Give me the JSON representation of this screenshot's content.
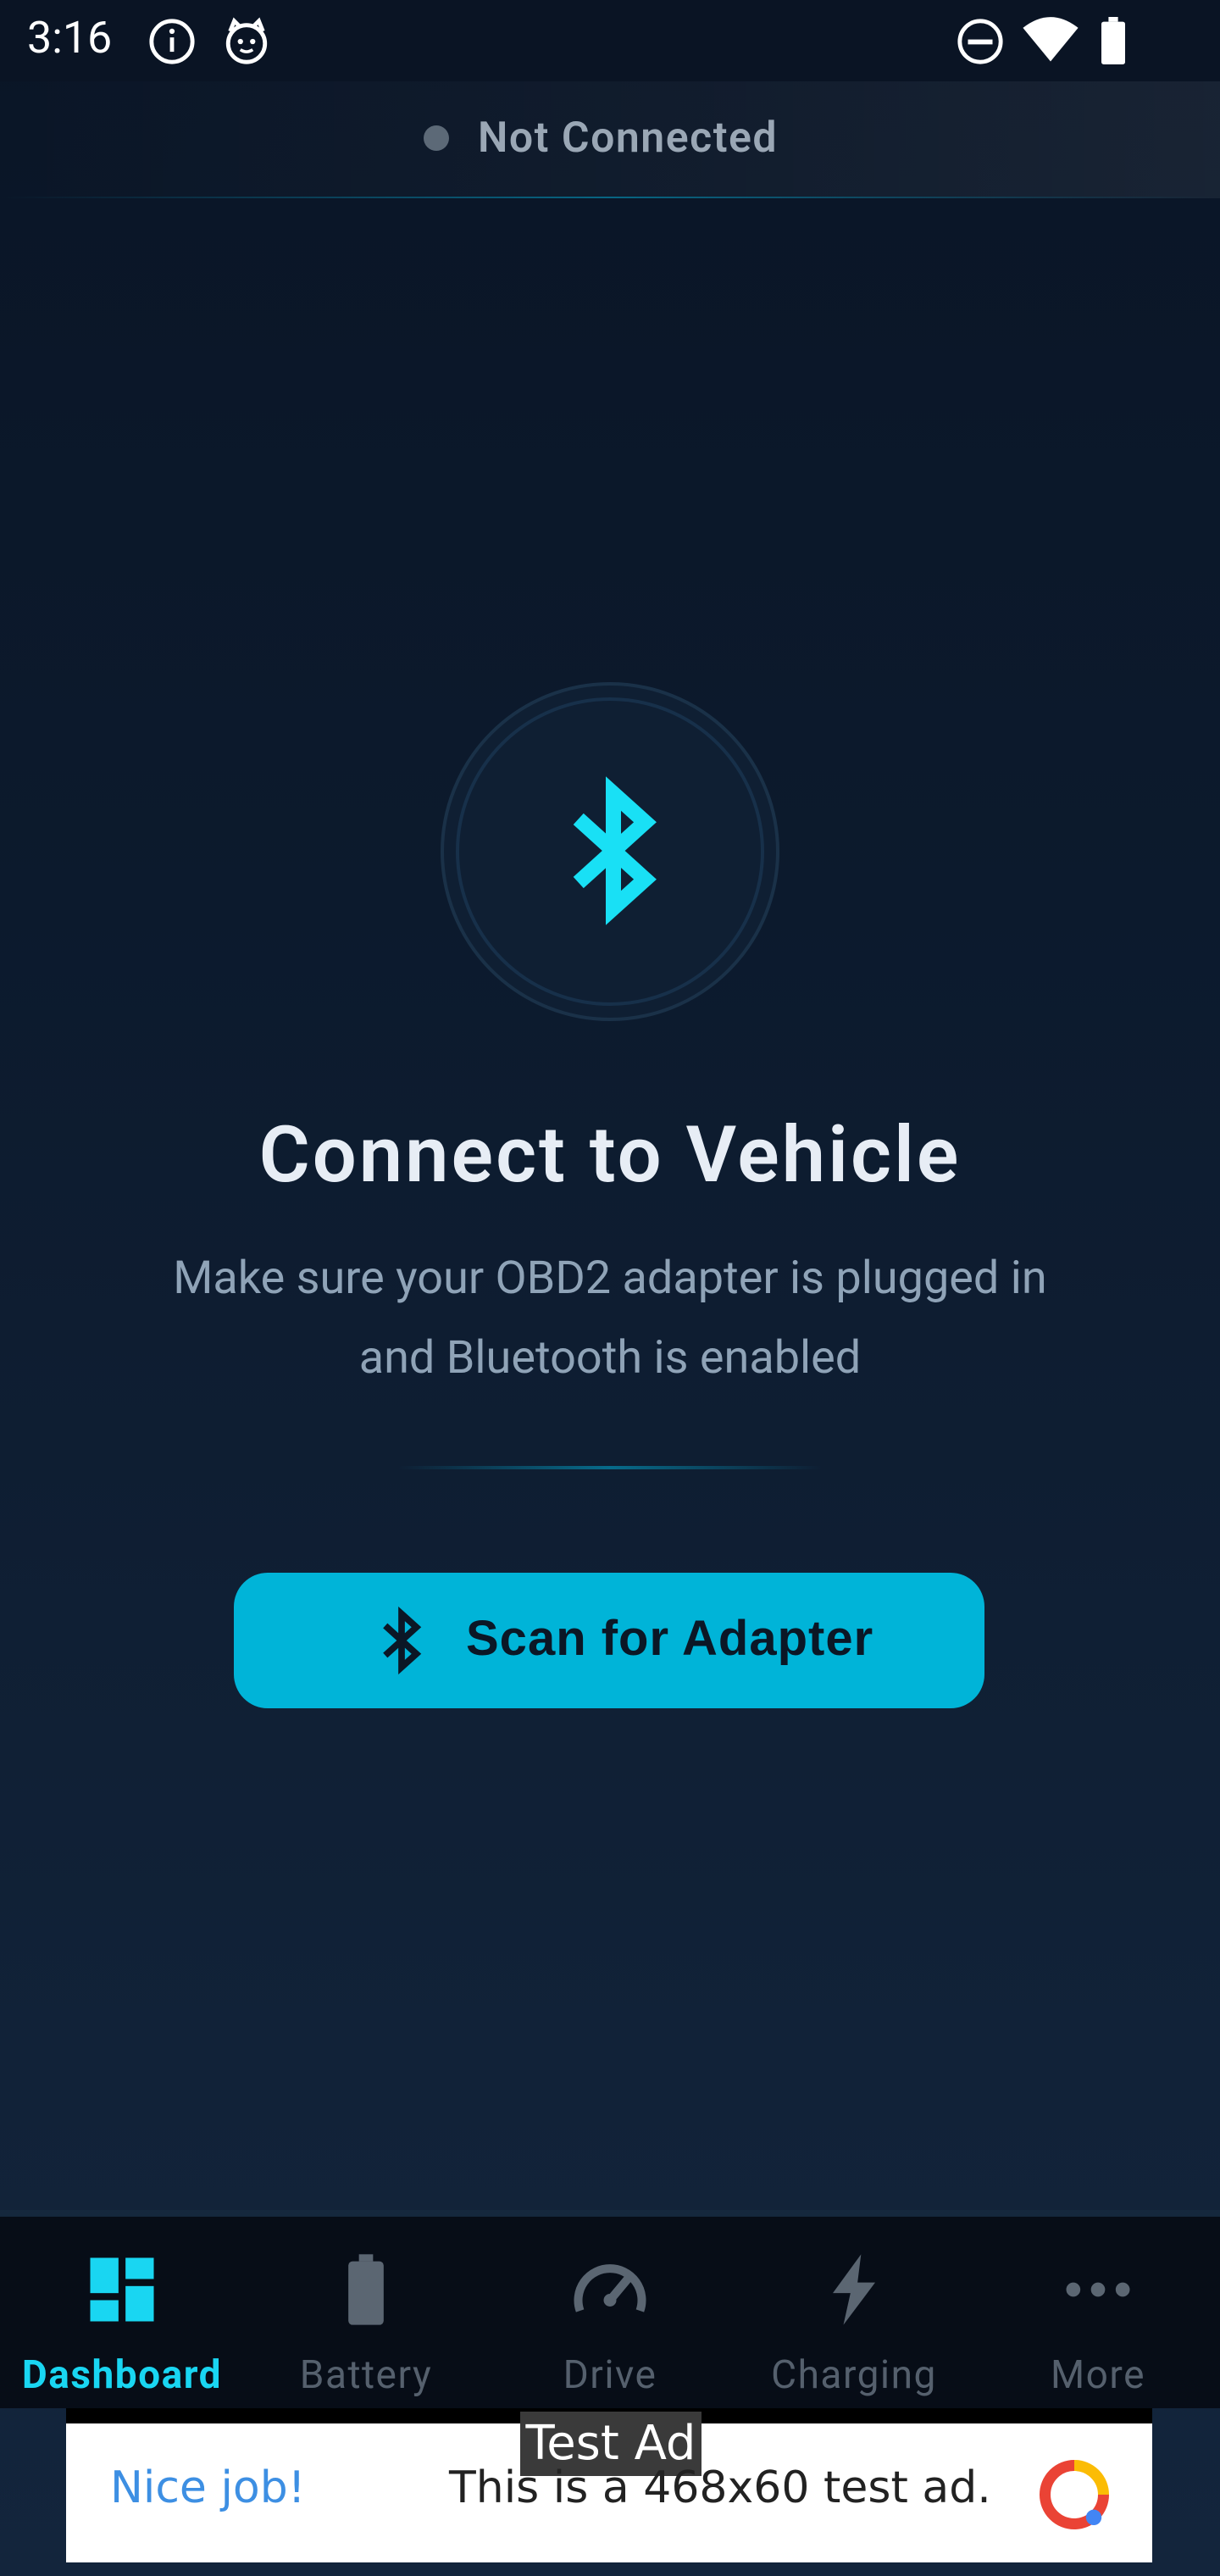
{
  "status_bar": {
    "time": "3:16",
    "left_icons": [
      "info-icon",
      "cat-icon"
    ],
    "right_icons": [
      "do-not-disturb-icon",
      "wifi-icon",
      "battery-icon"
    ]
  },
  "connection": {
    "status_text": "Not Connected",
    "status_color": "#5c6977"
  },
  "main": {
    "icon": "bluetooth-icon",
    "title": "Connect to Vehicle",
    "subtitle_line1": "Make sure your OBD2 adapter is plugged in",
    "subtitle_line2": "and Bluetooth is enabled",
    "scan_button_label": "Scan for Adapter",
    "accent_color": "#00b4d8"
  },
  "bottom_nav": {
    "items": [
      {
        "label": "Dashboard",
        "icon": "dashboard-icon",
        "active": true
      },
      {
        "label": "Battery",
        "icon": "battery-icon",
        "active": false
      },
      {
        "label": "Drive",
        "icon": "speedometer-icon",
        "active": false
      },
      {
        "label": "Charging",
        "icon": "lightning-icon",
        "active": false
      },
      {
        "label": "More",
        "icon": "more-dots-icon",
        "active": false
      }
    ]
  },
  "ad": {
    "badge": "Test Ad",
    "headline": "Nice job!",
    "text": "This is a 468x60 test ad."
  }
}
